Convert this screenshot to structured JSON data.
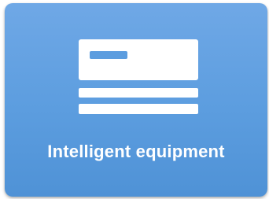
{
  "tile": {
    "label": "Intelligent equipment",
    "icon": "equipment-panel-icon",
    "background_color": "#5c9ddf",
    "icon_color": "#ffffff"
  }
}
